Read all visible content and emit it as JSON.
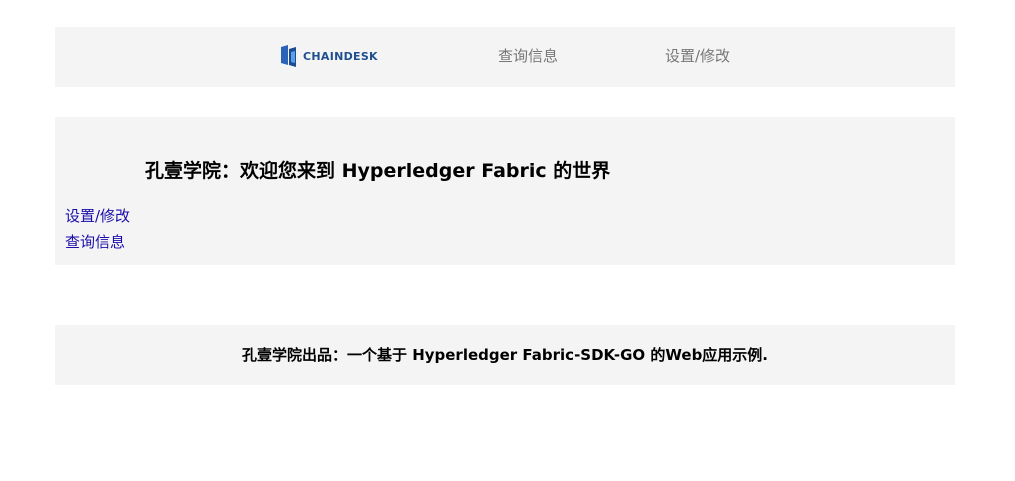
{
  "nav": {
    "logo_text": "CHAINDESK",
    "logo_icon": "chaindesk-logo-icon",
    "query_label": "查询信息",
    "settings_label": "设置/修改"
  },
  "hero": {
    "title": "孔壹学院：欢迎您来到 Hyperledger Fabric 的世界",
    "link_settings": "设置/修改",
    "link_query": "查询信息"
  },
  "footer": {
    "text": "孔壹学院出品：一个基于 Hyperledger Fabric-SDK-GO 的Web应用示例."
  },
  "colors": {
    "panel_background": "#f4f4f4",
    "nav_link": "#777777",
    "link": "#1a0dab",
    "logo_blue": "#1f4f8f"
  }
}
